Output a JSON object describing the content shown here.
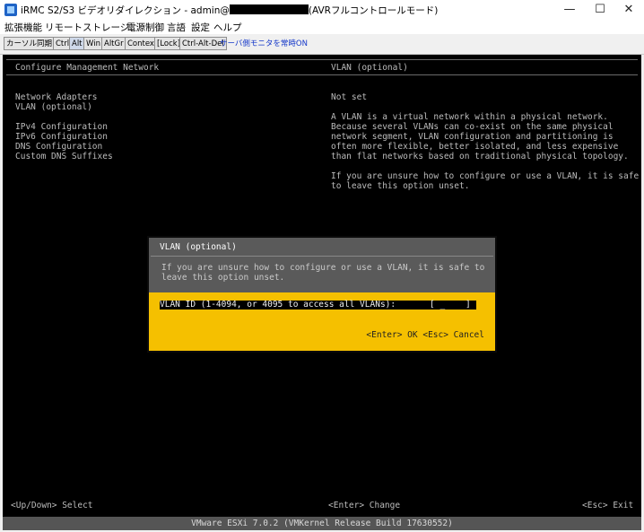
{
  "window": {
    "title_prefix": "iRMC S2/S3 ビデオリダイレクション - admin@",
    "title_suffix": "(AVRフルコントロールモード)",
    "minimize_label": "—",
    "maximize_label": "☐",
    "close_label": "✕"
  },
  "menu": [
    "拡張機能",
    "リモートストレージ",
    "電源制御",
    "言語",
    "設定",
    "ヘルプ"
  ],
  "toolbar": {
    "buttons": [
      "カーソル同期",
      "Ctrl",
      "Alt",
      "Win",
      "AltGr",
      "Context",
      "[Lock]",
      "Ctrl-Alt-Del"
    ],
    "link": "サーバ側モニタを常時ON"
  },
  "console": {
    "left_header": "Configure Management Network",
    "right_header": "VLAN (optional)",
    "menu_items": [
      "Network Adapters",
      "VLAN (optional)",
      "IPv4 Configuration",
      "IPv6 Configuration",
      "DNS Configuration",
      "Custom DNS Suffixes"
    ],
    "status": "Not set",
    "description": [
      "A VLAN is a virtual network within a physical network.",
      "Because several VLANs can co-exist on the same physical",
      "network segment, VLAN configuration and partitioning is",
      "often more flexible, better isolated, and less expensive",
      "than flat networks based on traditional physical topology."
    ],
    "advice": [
      "If you are unsure how to configure or use a VLAN, it is safe",
      "to leave this option unset."
    ],
    "dialog": {
      "title": "VLAN (optional)",
      "message": [
        "If you are unsure how to configure or use a VLAN, it is safe to",
        "leave this option unset."
      ],
      "field_label": "VLAN ID (1-4094, or 4095 to access all VLANs):",
      "field_value": "[ _    ]",
      "ok": "<Enter> OK",
      "cancel": "<Esc> Cancel"
    },
    "hints": {
      "select": "<Up/Down> Select",
      "change": "<Enter> Change",
      "exit": "<Esc> Exit"
    },
    "footer": "VMware ESXi 7.0.2 (VMKernel Release Build 17630552)"
  },
  "colors": {
    "dialog_accent": "#f5c000",
    "console_bg": "#000000",
    "console_text": "#bcbcbc"
  }
}
